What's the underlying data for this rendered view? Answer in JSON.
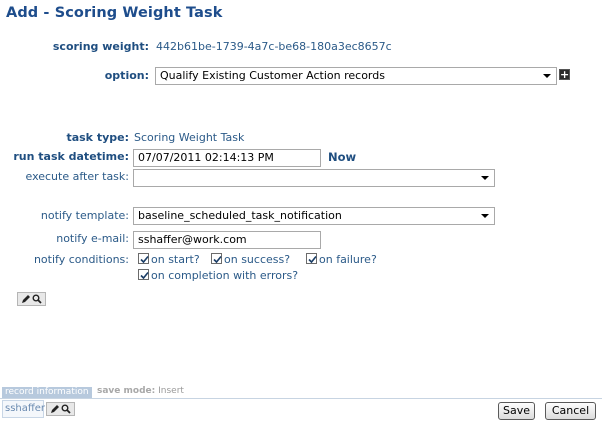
{
  "page": {
    "title": "Add - Scoring Weight Task"
  },
  "form": {
    "scoring_weight": {
      "label": "scoring weight:",
      "value": "442b61be-1739-4a7c-be68-180a3ec8657c"
    },
    "option": {
      "label": "option:",
      "value": "Qualify Existing Customer Action records"
    },
    "task_type": {
      "label": "task type:",
      "value": "Scoring Weight Task"
    },
    "run_task_datetime": {
      "label": "run task datetime:",
      "value": "07/07/2011 02:14:13 PM",
      "now_label": "Now"
    },
    "execute_after_task": {
      "label": "execute after task:",
      "value": ""
    },
    "notify_template": {
      "label": "notify template:",
      "value": "baseline_scheduled_task_notification"
    },
    "notify_email": {
      "label": "notify e-mail:",
      "value": "sshaffer@work.com"
    },
    "notify_conditions": {
      "label": "notify conditions:",
      "options": [
        {
          "label": "on start?",
          "checked": true
        },
        {
          "label": "on success?",
          "checked": true
        },
        {
          "label": "on failure?",
          "checked": true
        },
        {
          "label": "on completion with errors?",
          "checked": true
        }
      ]
    }
  },
  "footer": {
    "record_information": "record information",
    "save_mode_label": "save mode:",
    "save_mode_value": "Insert",
    "user": "sshaffer",
    "save_label": "Save",
    "cancel_label": "Cancel"
  },
  "icons": {
    "edit": "pencil-icon",
    "lookup": "magnifier-icon",
    "add": "plus-icon",
    "checkmark": "check-icon"
  }
}
